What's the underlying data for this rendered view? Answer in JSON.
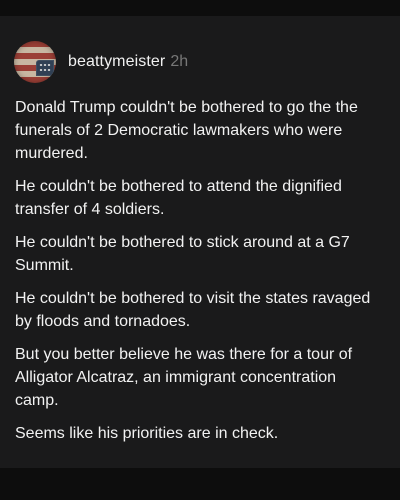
{
  "post": {
    "author": "beattymeister",
    "timestamp": "2h",
    "avatar_icon": "flag-avatar-icon",
    "paragraphs": [
      "Donald Trump couldn't be bothered to go the the funerals of 2 Democratic lawmakers who were murdered.",
      "He couldn't be bothered to attend the dignified transfer of 4 soldiers.",
      "He couldn't be bothered to stick around at a G7 Summit.",
      "He couldn't be bothered to visit the states ravaged by floods and tornadoes.",
      "But you better believe he was there for a tour of Alligator Alcatraz, an immigrant concentration camp.",
      "Seems like his priorities are in check."
    ]
  },
  "colors": {
    "page_background": "#0d0d0d",
    "card_background": "#1a1a1b",
    "text": "#f2f2f2",
    "timestamp": "#777777"
  }
}
